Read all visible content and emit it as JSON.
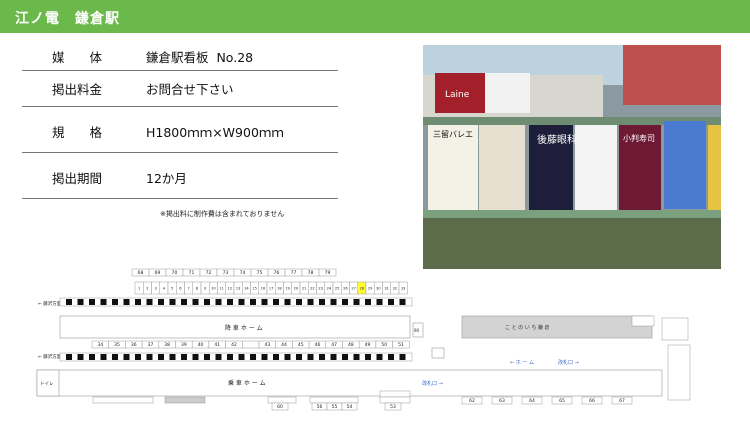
{
  "header": {
    "title": "江ノ電　鎌倉駅"
  },
  "info_rows": [
    {
      "label": "媒　　体",
      "value": "鎌倉駅看板  No.28"
    },
    {
      "label": "掲出料金",
      "value": "お問合せ下さい"
    },
    {
      "label": "規　　格",
      "value": "H1800ｍｍ×W900ｍｍ"
    },
    {
      "label": "掲出期間",
      "value": "12か月"
    }
  ],
  "note": "※掲出料に制作費は含まれておりません",
  "photo": {
    "signs": [
      "三留バレエ",
      "後藤眼科",
      "小判寿司",
      "Laine"
    ]
  },
  "map": {
    "highlight_number": "28",
    "highlight_color": "#ffff33",
    "top_small_numbers": [
      "68",
      "69",
      "70",
      "71",
      "72",
      "73",
      "74",
      "75",
      "76",
      "77",
      "78",
      "79"
    ],
    "top_numbers": [
      "1",
      "2",
      "3",
      "4",
      "5",
      "6",
      "7",
      "8",
      "9",
      "10",
      "11",
      "12",
      "13",
      "14",
      "15",
      "16",
      "17",
      "18",
      "19",
      "20",
      "21",
      "22",
      "23",
      "24",
      "25",
      "26",
      "27",
      "28",
      "29",
      "30",
      "31",
      "32",
      "33"
    ],
    "mid_numbers": [
      "34",
      "35",
      "36",
      "37",
      "38",
      "39",
      "40",
      "41",
      "42",
      "",
      "43",
      "44",
      "45",
      "46",
      "47",
      "48",
      "49",
      "50",
      "51"
    ],
    "bottom_numbers_a": [
      "60"
    ],
    "bottom_numbers_b": [
      "56",
      "55",
      "54"
    ],
    "bottom_numbers_c": [
      "53"
    ],
    "bottom_numbers_d": [
      "62",
      "63",
      "64",
      "65",
      "66",
      "67"
    ],
    "platform_upper": "降 車 ホ ー ム",
    "platform_lower": "乗 車 ホ ー ム",
    "concourse": "こ と の い ち 鎌 倉",
    "home_label": "← ホ ー ム",
    "gate_label": "改札口 →",
    "gate_label2": "改札口 →",
    "left_dir_top": "← 藤沢方面",
    "left_dir_bottom": "← 藤沢方面",
    "toilet": "トイレ",
    "small_number_right": "90",
    "misc_labels": [
      "駅事務室",
      "窓口",
      "階段",
      "精算所",
      "改札口",
      "改札"
    ]
  }
}
